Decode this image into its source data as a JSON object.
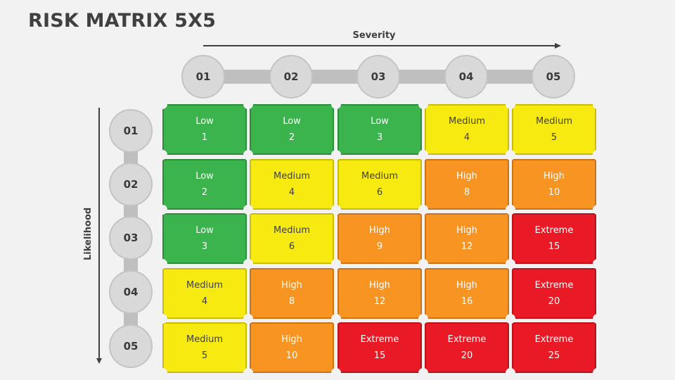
{
  "title": "RISK MATRIX 5X5",
  "axes": {
    "severity_label": "Severity",
    "likelihood_label": "Likelihood",
    "severity_levels": [
      "01",
      "02",
      "03",
      "04",
      "05"
    ],
    "likelihood_levels": [
      "01",
      "02",
      "03",
      "04",
      "05"
    ]
  },
  "colors": {
    "Low": "#3cb44d",
    "Medium": "#f7ea10",
    "High": "#f79422",
    "Extreme": "#e91a25"
  },
  "matrix": [
    [
      {
        "level": "Low",
        "score": "1"
      },
      {
        "level": "Low",
        "score": "2"
      },
      {
        "level": "Low",
        "score": "3"
      },
      {
        "level": "Medium",
        "score": "4"
      },
      {
        "level": "Medium",
        "score": "5"
      }
    ],
    [
      {
        "level": "Low",
        "score": "2"
      },
      {
        "level": "Medium",
        "score": "4"
      },
      {
        "level": "Medium",
        "score": "6"
      },
      {
        "level": "High",
        "score": "8"
      },
      {
        "level": "High",
        "score": "10"
      }
    ],
    [
      {
        "level": "Low",
        "score": "3"
      },
      {
        "level": "Medium",
        "score": "6"
      },
      {
        "level": "High",
        "score": "9"
      },
      {
        "level": "High",
        "score": "12"
      },
      {
        "level": "Extreme",
        "score": "15"
      }
    ],
    [
      {
        "level": "Medium",
        "score": "4"
      },
      {
        "level": "High",
        "score": "8"
      },
      {
        "level": "High",
        "score": "12"
      },
      {
        "level": "High",
        "score": "16"
      },
      {
        "level": "Extreme",
        "score": "20"
      }
    ],
    [
      {
        "level": "Medium",
        "score": "5"
      },
      {
        "level": "High",
        "score": "10"
      },
      {
        "level": "Extreme",
        "score": "15"
      },
      {
        "level": "Extreme",
        "score": "20"
      },
      {
        "level": "Extreme",
        "score": "25"
      }
    ]
  ]
}
